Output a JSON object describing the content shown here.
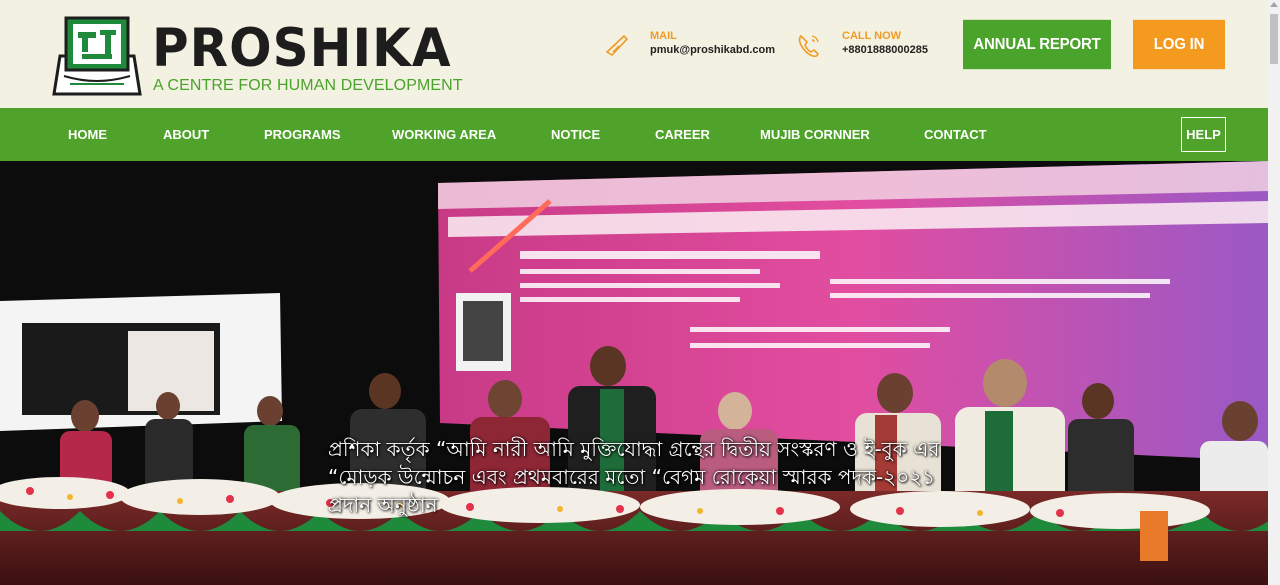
{
  "header": {
    "brand_name": "PROSHIKA",
    "tagline": "A CENTRE FOR HUMAN DEVELOPMENT",
    "mail": {
      "label": "MAIL",
      "value": "pmuk@proshikabd.com",
      "icon": "mail-icon"
    },
    "call": {
      "label": "CALL NOW",
      "value": "+8801888000285",
      "icon": "phone-icon"
    },
    "annual_report_label": "ANNUAL REPORT",
    "login_label": "LOG IN"
  },
  "nav": {
    "items": [
      {
        "label": "HOME"
      },
      {
        "label": "ABOUT"
      },
      {
        "label": "PROGRAMS"
      },
      {
        "label": "WORKING AREA"
      },
      {
        "label": "NOTICE"
      },
      {
        "label": "CAREER"
      },
      {
        "label": "MUJIB CORNNER"
      },
      {
        "label": "CONTACT"
      }
    ],
    "help_label": "HELP"
  },
  "hero": {
    "caption": "প্রশিকা কর্তৃক “আমি নারী আমি মুক্তিযোদ্ধা গ্রন্থের দ্বিতীয় সংস্করণ ও ই-বুক এর “মোড়ক উন্মোচন এবং প্রথমবারের মতো “বেগম রোকেয়া স্মারক পদক-২০২১ প্রদান অনুষ্ঠান"
  },
  "colors": {
    "header_bg": "#f3f1e2",
    "brand_green": "#4aa32a",
    "nav_green": "#4fa32a",
    "accent_orange": "#f39a1f"
  }
}
